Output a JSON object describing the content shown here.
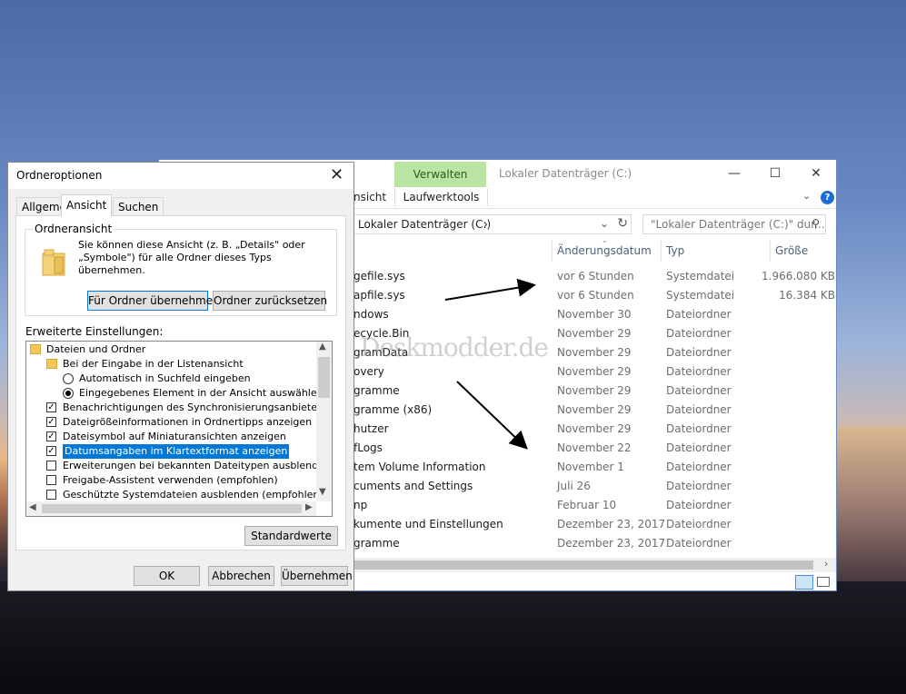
{
  "explorer": {
    "title": "Lokaler Datenträger (C:)",
    "context_tab": "Verwalten",
    "ribbon_tabs": [
      "Ansicht",
      "Laufwerktools"
    ],
    "ribbon_partial": "nsicht",
    "address": "Lokaler Datenträger (C:)",
    "search_placeholder": "\"Lokaler Datenträger (C:)\" dur...",
    "columns": {
      "date": "Änderungsdatum",
      "type": "Typ",
      "size": "Größe"
    },
    "rows": [
      {
        "name": "gefile.sys",
        "date": "vor 6 Stunden",
        "type": "Systemdatei",
        "size": "1.966.080 KB"
      },
      {
        "name": "apfile.sys",
        "date": "vor 6 Stunden",
        "type": "Systemdatei",
        "size": "16.384 KB"
      },
      {
        "name": "ndows",
        "date": "November 30",
        "type": "Dateiordner",
        "size": ""
      },
      {
        "name": "ecycle.Bin",
        "date": "November 29",
        "type": "Dateiordner",
        "size": ""
      },
      {
        "name": "gramData",
        "date": "November 29",
        "type": "Dateiordner",
        "size": ""
      },
      {
        "name": "overy",
        "date": "November 29",
        "type": "Dateiordner",
        "size": ""
      },
      {
        "name": "gramme",
        "date": "November 29",
        "type": "Dateiordner",
        "size": ""
      },
      {
        "name": "gramme (x86)",
        "date": "November 29",
        "type": "Dateiordner",
        "size": ""
      },
      {
        "name": "hutzer",
        "date": "November 29",
        "type": "Dateiordner",
        "size": ""
      },
      {
        "name": "fLogs",
        "date": "November 22",
        "type": "Dateiordner",
        "size": ""
      },
      {
        "name": "tem Volume Information",
        "date": "November 1",
        "type": "Dateiordner",
        "size": ""
      },
      {
        "name": "cuments and Settings",
        "date": "Juli 26",
        "type": "Dateiordner",
        "size": ""
      },
      {
        "name": "np",
        "date": "Februar 10",
        "type": "Dateiordner",
        "size": ""
      },
      {
        "name": "kumente und Einstellungen",
        "date": "Dezember 23, 2017",
        "type": "Dateiordner",
        "size": ""
      },
      {
        "name": "gramme",
        "date": "Dezember 23, 2017",
        "type": "Dateiordner",
        "size": ""
      }
    ]
  },
  "watermark": "Deskmodder.de",
  "dialog": {
    "title": "Ordneroptionen",
    "tabs": [
      "Allgemein",
      "Ansicht",
      "Suchen"
    ],
    "active_tab": "Ansicht",
    "group_label": "Ordneransicht",
    "group_text": "Sie können diese Ansicht (z. B. „Details\" oder „Symbole\") für alle Ordner dieses Typs übernehmen.",
    "apply_button": "Für Ordner übernehmen",
    "reset_button": "Ordner zurücksetzen",
    "advanced_label": "Erweiterte Einstellungen:",
    "tree": [
      {
        "kind": "folder",
        "label": "Dateien und Ordner"
      },
      {
        "kind": "folder",
        "label": "Bei der Eingabe in der Listenansicht"
      },
      {
        "kind": "radio",
        "checked": false,
        "label": "Automatisch in Suchfeld eingeben"
      },
      {
        "kind": "radio",
        "checked": true,
        "label": "Eingegebenes Element in der Ansicht auswählen"
      },
      {
        "kind": "check",
        "checked": true,
        "label": "Benachrichtigungen des Synchronisierungsanbieters anzeigen"
      },
      {
        "kind": "check",
        "checked": true,
        "label": "Dateigrößeinformationen in Ordnertipps anzeigen"
      },
      {
        "kind": "check",
        "checked": true,
        "label": "Dateisymbol auf Miniaturansichten anzeigen"
      },
      {
        "kind": "check",
        "checked": true,
        "label": "Datumsangaben im Klartextformat anzeigen",
        "selected": true
      },
      {
        "kind": "check",
        "checked": false,
        "label": "Erweiterungen bei bekannten Dateitypen ausblenden"
      },
      {
        "kind": "check",
        "checked": false,
        "label": "Freigabe-Assistent verwenden (empfohlen)"
      },
      {
        "kind": "check",
        "checked": false,
        "label": "Geschützte Systemdateien ausblenden (empfohlen)"
      }
    ],
    "defaults_button": "Standardwerte",
    "ok_button": "OK",
    "cancel_button": "Abbrechen",
    "apply_all_button": "Übernehmen"
  }
}
